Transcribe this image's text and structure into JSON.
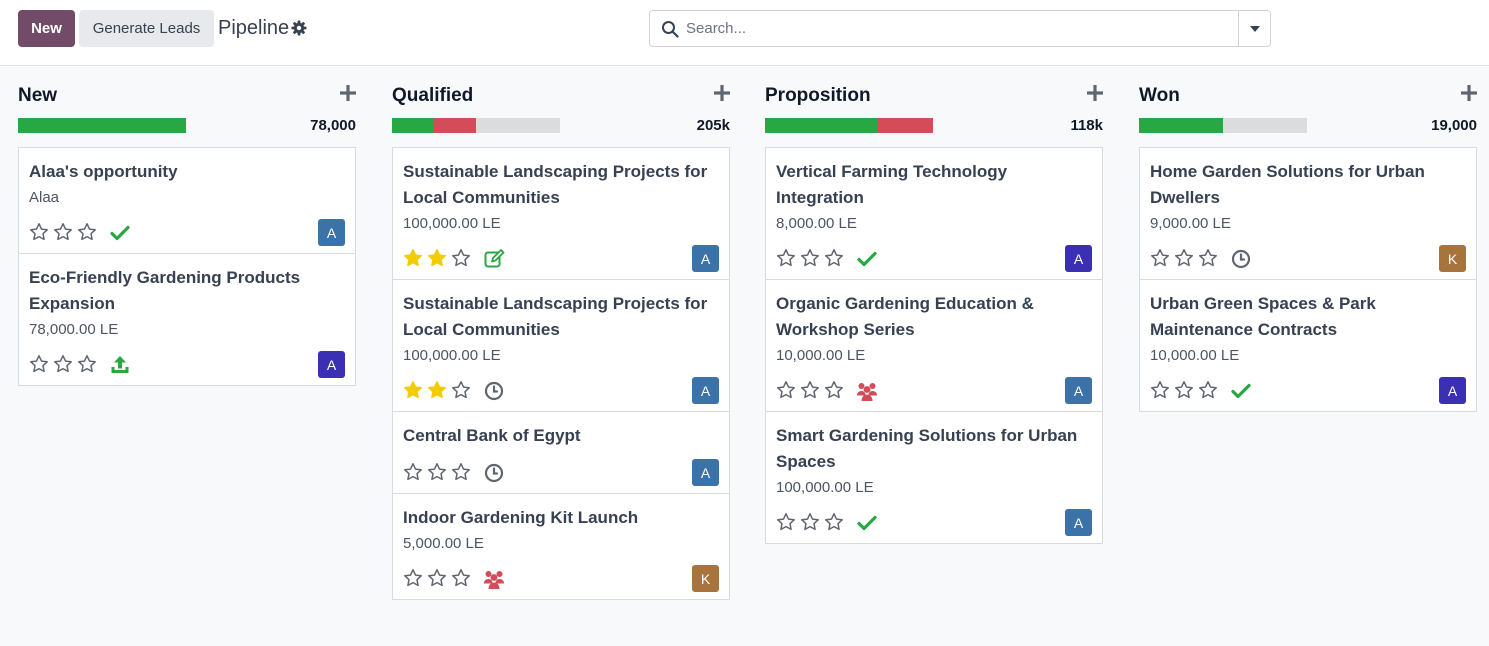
{
  "toolbar": {
    "new_label": "New",
    "generate_label": "Generate Leads",
    "title": "Pipeline",
    "settings_icon": "gear-icon"
  },
  "search": {
    "placeholder": "Search...",
    "icon": "search-icon",
    "toggle_icon": "caret-down-icon"
  },
  "colors": {
    "brand": "#714b67",
    "green": "#28a745",
    "red": "#d44c59",
    "gold": "#f3cc00",
    "avatar_blue": "#3b72a8",
    "avatar_indigo": "#3b30b4",
    "avatar_brown": "#a7743d"
  },
  "columns": [
    {
      "title": "New",
      "total": "78,000",
      "progress": [
        {
          "color": "#28a745",
          "fraction": 1.0
        }
      ],
      "cards": [
        {
          "title": "Alaa's opportunity",
          "subtitle": "Alaa",
          "stars": 0,
          "activity": "check",
          "avatar": "A",
          "avatar_color": "#3b72a8"
        },
        {
          "title": "Eco-Friendly Gardening Products Expansion",
          "subtitle": "78,000.00 LE",
          "stars": 0,
          "activity": "upload",
          "avatar": "A",
          "avatar_color": "#3b30b4"
        }
      ]
    },
    {
      "title": "Qualified",
      "total": "205k",
      "progress": [
        {
          "color": "#28a745",
          "fraction": 0.25
        },
        {
          "color": "#d44c59",
          "fraction": 0.25
        }
      ],
      "cards": [
        {
          "title": "Sustainable Landscaping Projects for Local Communities",
          "subtitle": "100,000.00 LE",
          "stars": 2,
          "activity": "edit",
          "avatar": "A",
          "avatar_color": "#3b72a8"
        },
        {
          "title": "Sustainable Landscaping Projects for Local Communities",
          "subtitle": "100,000.00 LE",
          "stars": 2,
          "activity": "clock",
          "avatar": "A",
          "avatar_color": "#3b72a8"
        },
        {
          "title": "Central Bank of Egypt",
          "subtitle": "",
          "stars": 0,
          "activity": "clock",
          "avatar": "A",
          "avatar_color": "#3b72a8"
        },
        {
          "title": "Indoor Gardening Kit Launch",
          "subtitle": "5,000.00 LE",
          "stars": 0,
          "activity": "users",
          "avatar": "K",
          "avatar_color": "#a7743d"
        }
      ]
    },
    {
      "title": "Proposition",
      "total": "118k",
      "progress": [
        {
          "color": "#28a745",
          "fraction": 0.67
        },
        {
          "color": "#d44c59",
          "fraction": 0.33
        }
      ],
      "cards": [
        {
          "title": "Vertical Farming Technology Integration",
          "subtitle": "8,000.00 LE",
          "stars": 0,
          "activity": "check",
          "avatar": "A",
          "avatar_color": "#3b30b4"
        },
        {
          "title": "Organic Gardening Education & Workshop Series",
          "subtitle": "10,000.00 LE",
          "stars": 0,
          "activity": "users",
          "avatar": "A",
          "avatar_color": "#3b72a8"
        },
        {
          "title": "Smart Gardening Solutions for Urban Spaces",
          "subtitle": "100,000.00 LE",
          "stars": 0,
          "activity": "check",
          "avatar": "A",
          "avatar_color": "#3b72a8"
        }
      ]
    },
    {
      "title": "Won",
      "total": "19,000",
      "progress": [
        {
          "color": "#28a745",
          "fraction": 0.5
        }
      ],
      "cards": [
        {
          "title": "Home Garden Solutions for Urban Dwellers",
          "subtitle": "9,000.00 LE",
          "stars": 0,
          "activity": "clock",
          "avatar": "K",
          "avatar_color": "#a7743d"
        },
        {
          "title": "Urban Green Spaces & Park Maintenance Contracts",
          "subtitle": "10,000.00 LE",
          "stars": 0,
          "activity": "check",
          "avatar": "A",
          "avatar_color": "#3b30b4"
        }
      ]
    }
  ]
}
